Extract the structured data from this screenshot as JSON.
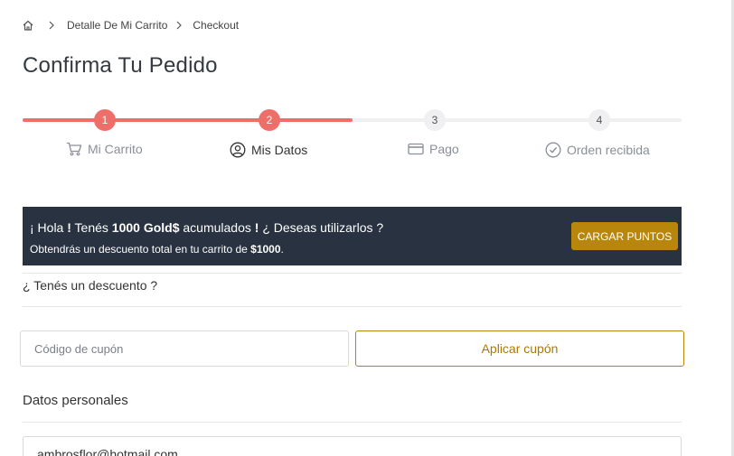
{
  "breadcrumb": {
    "home_icon": "home-icon",
    "items": [
      "Detalle De Mi Carrito",
      "Checkout"
    ]
  },
  "page_title": "Confirma Tu Pedido",
  "stepper": {
    "progress_percent": 50,
    "steps": [
      {
        "number": "1",
        "label": "Mi Carrito",
        "icon": "cart-icon",
        "state": "done"
      },
      {
        "number": "2",
        "label": "Mis Datos",
        "icon": "user-circle-icon",
        "state": "current"
      },
      {
        "number": "3",
        "label": "Pago",
        "icon": "credit-card-icon",
        "state": "pending"
      },
      {
        "number": "4",
        "label": "Orden recibida",
        "icon": "check-circle-icon",
        "state": "pending"
      }
    ]
  },
  "gold_banner": {
    "line1_a": "¡ Hola ",
    "line1_b": "!",
    "line1_c": " Tenés ",
    "line1_d": "1000 Gold$",
    "line1_e": " acumulados ",
    "line1_f": "!",
    "line1_g": " ¿ Deseas utilizarlos ?",
    "line2_a": "Obtendrás un descuento total en tu carrito de ",
    "line2_b": "$1000",
    "line2_c": ".",
    "button_label": "CARGAR PUNTOS"
  },
  "discount": {
    "question": "¿ Tenés un descuento ?",
    "coupon_placeholder": "Código de cupón",
    "apply_label": "Aplicar cupón"
  },
  "personal": {
    "title": "Datos personales",
    "email_value": "ambrosflor@hotmail.com"
  },
  "colors": {
    "accent_red": "#ee6f6a",
    "gold": "#b8860b",
    "banner_bg": "#283241"
  }
}
